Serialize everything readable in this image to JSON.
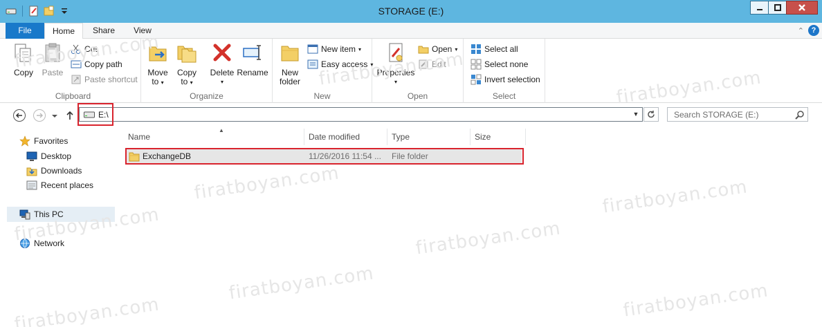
{
  "window": {
    "title": "STORAGE (E:)"
  },
  "ribbon_tabs": {
    "file": "File",
    "home": "Home",
    "share": "Share",
    "view": "View"
  },
  "ribbon": {
    "clipboard": {
      "label": "Clipboard",
      "copy": "Copy",
      "paste": "Paste",
      "cut": "Cut",
      "copy_path": "Copy path",
      "paste_shortcut": "Paste shortcut"
    },
    "organize": {
      "label": "Organize",
      "move_to_1": "Move",
      "move_to_2": "to",
      "copy_to_1": "Copy",
      "copy_to_2": "to",
      "delete": "Delete",
      "rename": "Rename"
    },
    "new": {
      "label": "New",
      "new_folder_1": "New",
      "new_folder_2": "folder",
      "new_item": "New item",
      "easy_access": "Easy access"
    },
    "open": {
      "label": "Open",
      "properties": "Properties",
      "open": "Open",
      "edit": "Edit"
    },
    "select": {
      "label": "Select",
      "select_all": "Select all",
      "select_none": "Select none",
      "invert_selection": "Invert selection"
    }
  },
  "address": {
    "path": "E:\\",
    "search_placeholder": "Search STORAGE (E:)"
  },
  "nav_pane": {
    "favorites": "Favorites",
    "desktop": "Desktop",
    "downloads": "Downloads",
    "recent_places": "Recent places",
    "this_pc": "This PC",
    "network": "Network"
  },
  "file_list": {
    "columns": [
      "Name",
      "Date modified",
      "Type",
      "Size"
    ],
    "rows": [
      {
        "name": "ExchangeDB",
        "date_modified": "11/26/2016 11:54 ...",
        "type": "File folder",
        "size": ""
      }
    ]
  },
  "watermark": "firatboyan.com",
  "colors": {
    "titlebar": "#5eb6e0",
    "file_tab": "#1979ca",
    "highlight_box": "#d9232d",
    "selected_row": "#e6e6e6"
  }
}
